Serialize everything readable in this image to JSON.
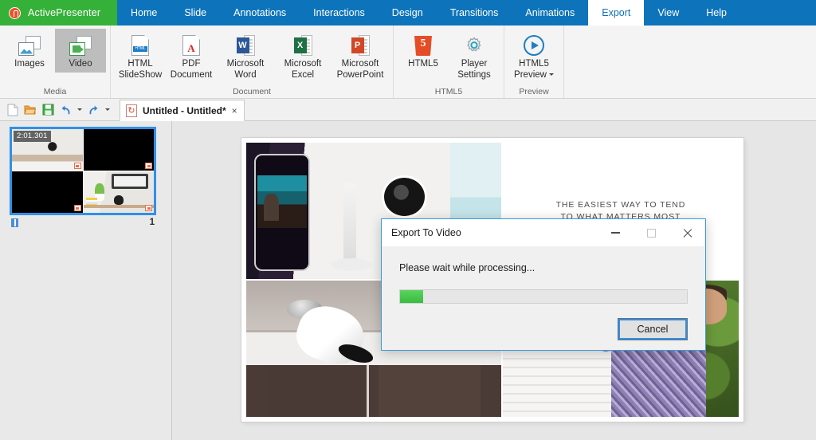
{
  "app": {
    "brand": "ActivePresenter",
    "brand_logo_icon": "activepresenter-logo-icon",
    "accent_blue": "#0d74bb",
    "accent_green": "#35b139"
  },
  "tabs": [
    {
      "label": "Home",
      "active": false
    },
    {
      "label": "Slide",
      "active": false
    },
    {
      "label": "Annotations",
      "active": false
    },
    {
      "label": "Interactions",
      "active": false
    },
    {
      "label": "Design",
      "active": false
    },
    {
      "label": "Transitions",
      "active": false
    },
    {
      "label": "Animations",
      "active": false
    },
    {
      "label": "Export",
      "active": true
    },
    {
      "label": "View",
      "active": false
    },
    {
      "label": "Help",
      "active": false
    }
  ],
  "ribbon": {
    "groups": [
      {
        "label": "Media",
        "buttons": [
          {
            "line1": "Images",
            "line2": "",
            "icon": "images-icon",
            "selected": false
          },
          {
            "line1": "Video",
            "line2": "",
            "icon": "video-icon",
            "selected": true
          }
        ]
      },
      {
        "label": "Document",
        "buttons": [
          {
            "line1": "HTML",
            "line2": "SlideShow",
            "icon": "html-slideshow-icon",
            "selected": false
          },
          {
            "line1": "PDF",
            "line2": "Document",
            "icon": "pdf-document-icon",
            "selected": false
          },
          {
            "line1": "Microsoft",
            "line2": "Word",
            "icon": "microsoft-word-icon",
            "selected": false
          },
          {
            "line1": "Microsoft",
            "line2": "Excel",
            "icon": "microsoft-excel-icon",
            "selected": false
          },
          {
            "line1": "Microsoft",
            "line2": "PowerPoint",
            "icon": "microsoft-powerpoint-icon",
            "selected": false
          }
        ]
      },
      {
        "label": "HTML5",
        "buttons": [
          {
            "line1": "HTML5",
            "line2": "",
            "icon": "html5-icon",
            "selected": false
          },
          {
            "line1": "Player",
            "line2": "Settings",
            "icon": "player-settings-gear-icon",
            "selected": false
          }
        ]
      },
      {
        "label": "Preview",
        "buttons": [
          {
            "line1": "HTML5",
            "line2": "Preview",
            "icon": "html5-preview-play-icon",
            "selected": false,
            "has_caret": true
          }
        ]
      }
    ]
  },
  "quick_access": {
    "buttons": [
      {
        "name": "new-icon",
        "glyph": "new"
      },
      {
        "name": "open-icon",
        "glyph": "open"
      },
      {
        "name": "save-icon",
        "glyph": "save"
      },
      {
        "name": "undo-icon",
        "glyph": "undo"
      },
      {
        "name": "redo-icon",
        "glyph": "redo"
      }
    ]
  },
  "document_tab": {
    "icon": "activepresenter-file-icon",
    "title": "Untitled - Untitled*",
    "close_label": "×"
  },
  "slide_panel": {
    "slides": [
      {
        "duration": "2:01.301",
        "number": "1",
        "selected": true,
        "notes_icon": "slide-notes-icon"
      }
    ]
  },
  "canvas": {
    "slide": {
      "tagline_line1": "THE EASIEST WAY TO TEND",
      "tagline_line2": "TO WHAT MATTERS MOST"
    }
  },
  "dialog": {
    "title": "Export To Video",
    "message": "Please wait while processing...",
    "progress_percent": 8,
    "progress_fill_color": "#37bc3e",
    "buttons": {
      "minimize": "minimize-icon",
      "maximize": "maximize-icon",
      "close": "close-icon",
      "cancel_label": "Cancel"
    }
  }
}
